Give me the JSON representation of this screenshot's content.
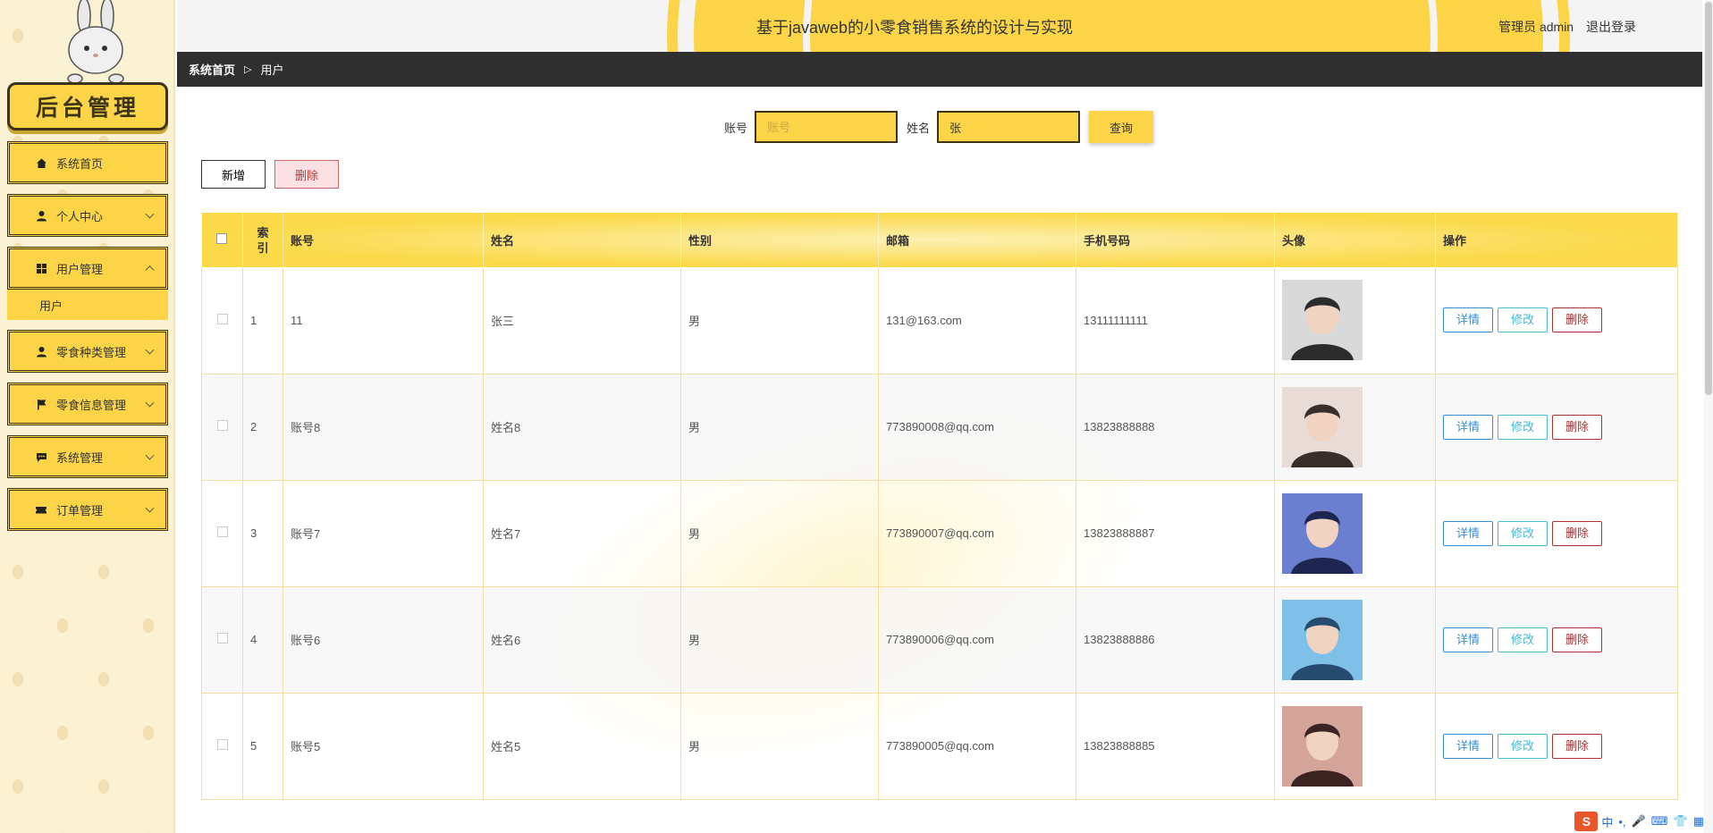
{
  "colors": {
    "accent": "#fbd448",
    "dark": "#3d3418",
    "breadcrumb_bg": "#2f2f2f"
  },
  "sidebar": {
    "brand": "后台管理",
    "items": [
      {
        "label": "系统首页",
        "icon": "home-icon"
      },
      {
        "label": "个人中心",
        "icon": "person-icon"
      },
      {
        "label": "用户管理",
        "icon": "grid-icon",
        "expanded": true
      },
      {
        "label": "零食种类管理",
        "icon": "person-icon"
      },
      {
        "label": "零食信息管理",
        "icon": "flag-icon"
      },
      {
        "label": "系统管理",
        "icon": "chat-icon"
      },
      {
        "label": "订单管理",
        "icon": "ticket-icon"
      }
    ],
    "submenu_user": "用户"
  },
  "header": {
    "title": "基于javaweb的小零食销售系统的设计与实现",
    "user": "管理员 admin",
    "logout": "退出登录"
  },
  "breadcrumb": {
    "home": "系统首页",
    "current": "用户"
  },
  "search": {
    "account_label": "账号",
    "account_placeholder": "账号",
    "name_label": "姓名",
    "name_value": "张",
    "query_button": "查询"
  },
  "actions": {
    "add": "新增",
    "delete": "删除"
  },
  "table": {
    "headers": [
      "索引",
      "账号",
      "姓名",
      "性别",
      "邮箱",
      "手机号码",
      "头像",
      "操作"
    ],
    "index_header_line1": "索",
    "index_header_line2": "引",
    "rows": [
      {
        "index": "1",
        "account": "11",
        "name": "张三",
        "gender": "男",
        "email": "131@163.com",
        "phone": "13111111111"
      },
      {
        "index": "2",
        "account": "账号8",
        "name": "姓名8",
        "gender": "男",
        "email": "773890008@qq.com",
        "phone": "13823888888"
      },
      {
        "index": "3",
        "account": "账号7",
        "name": "姓名7",
        "gender": "男",
        "email": "773890007@qq.com",
        "phone": "13823888887"
      },
      {
        "index": "4",
        "account": "账号6",
        "name": "姓名6",
        "gender": "男",
        "email": "773890006@qq.com",
        "phone": "13823888886"
      },
      {
        "index": "5",
        "account": "账号5",
        "name": "姓名5",
        "gender": "男",
        "email": "773890005@qq.com",
        "phone": "13823888885"
      }
    ],
    "op_detail": "详情",
    "op_edit": "修改",
    "op_delete": "删除"
  },
  "ime": {
    "logo": "S",
    "mode": "中"
  }
}
